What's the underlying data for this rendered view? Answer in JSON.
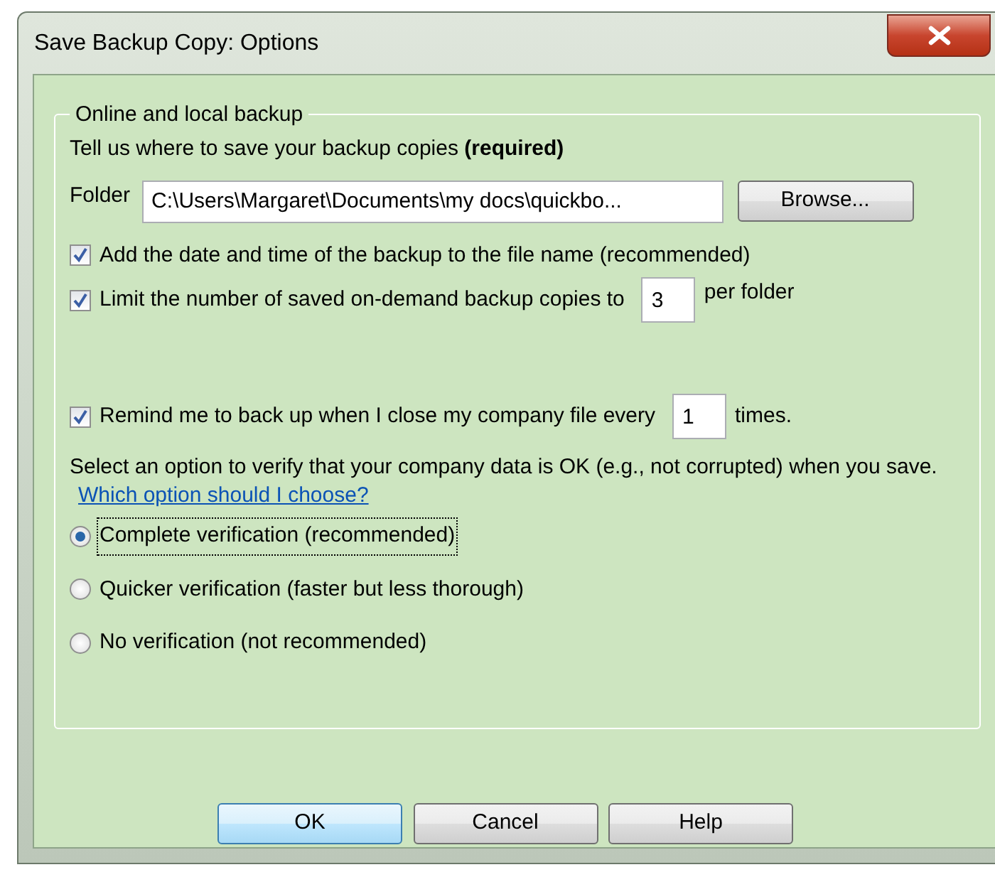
{
  "window": {
    "title": "Save Backup Copy: Options"
  },
  "group": {
    "legend": "Online and local backup",
    "instruction": "Tell us where to save your backup copies **(required)**",
    "folder": {
      "label": "Folder",
      "value": "C:\\Users\\Margaret\\Documents\\my docs\\quickbo...",
      "button": "Browse..."
    },
    "options": [
      {
        "kind": "checkbox",
        "checked": true,
        "label": "Add the date and time of the backup to the file name (recommended)"
      },
      {
        "kind": "count",
        "checked": true,
        "label": "Limit the number of saved on-demand backup copies to",
        "value": "3",
        "suffix": "per folder"
      },
      {
        "kind": "count",
        "checked": true,
        "label": "Remind me to back up when I close my company file every",
        "value": "1",
        "suffix": "times."
      }
    ],
    "verify_text": "Select an option to verify that your company data is OK (e.g., not corrupted) when you save.",
    "verify_link": "Which option should I choose?",
    "radios": [
      {
        "label": "Complete verification (recommended)",
        "selected": true,
        "focused": true
      },
      {
        "label": "Quicker verification (faster but less thorough)",
        "selected": false,
        "focused": false
      },
      {
        "label": "No verification (not recommended)",
        "selected": false,
        "focused": false
      }
    ]
  },
  "buttons": [
    {
      "label": "OK",
      "default": true
    },
    {
      "label": "Cancel",
      "default": false
    },
    {
      "label": "Help",
      "default": false
    }
  ]
}
